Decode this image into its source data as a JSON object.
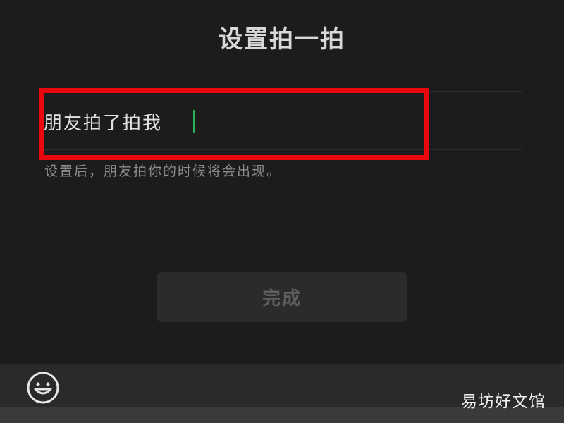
{
  "header": {
    "title": "设置拍一拍"
  },
  "input": {
    "value": "朋友拍了拍我",
    "caret_color": "#2bb35a"
  },
  "hint": {
    "text": "设置后，朋友拍你的时候将会出现。"
  },
  "actions": {
    "done_label": "完成"
  },
  "keyboard": {
    "emoji_icon": "emoji-icon"
  },
  "watermark": {
    "text": "易坊好文馆"
  },
  "colors": {
    "background": "#1c1c1c",
    "highlight": "#e8080e",
    "caret": "#2bb35a"
  }
}
